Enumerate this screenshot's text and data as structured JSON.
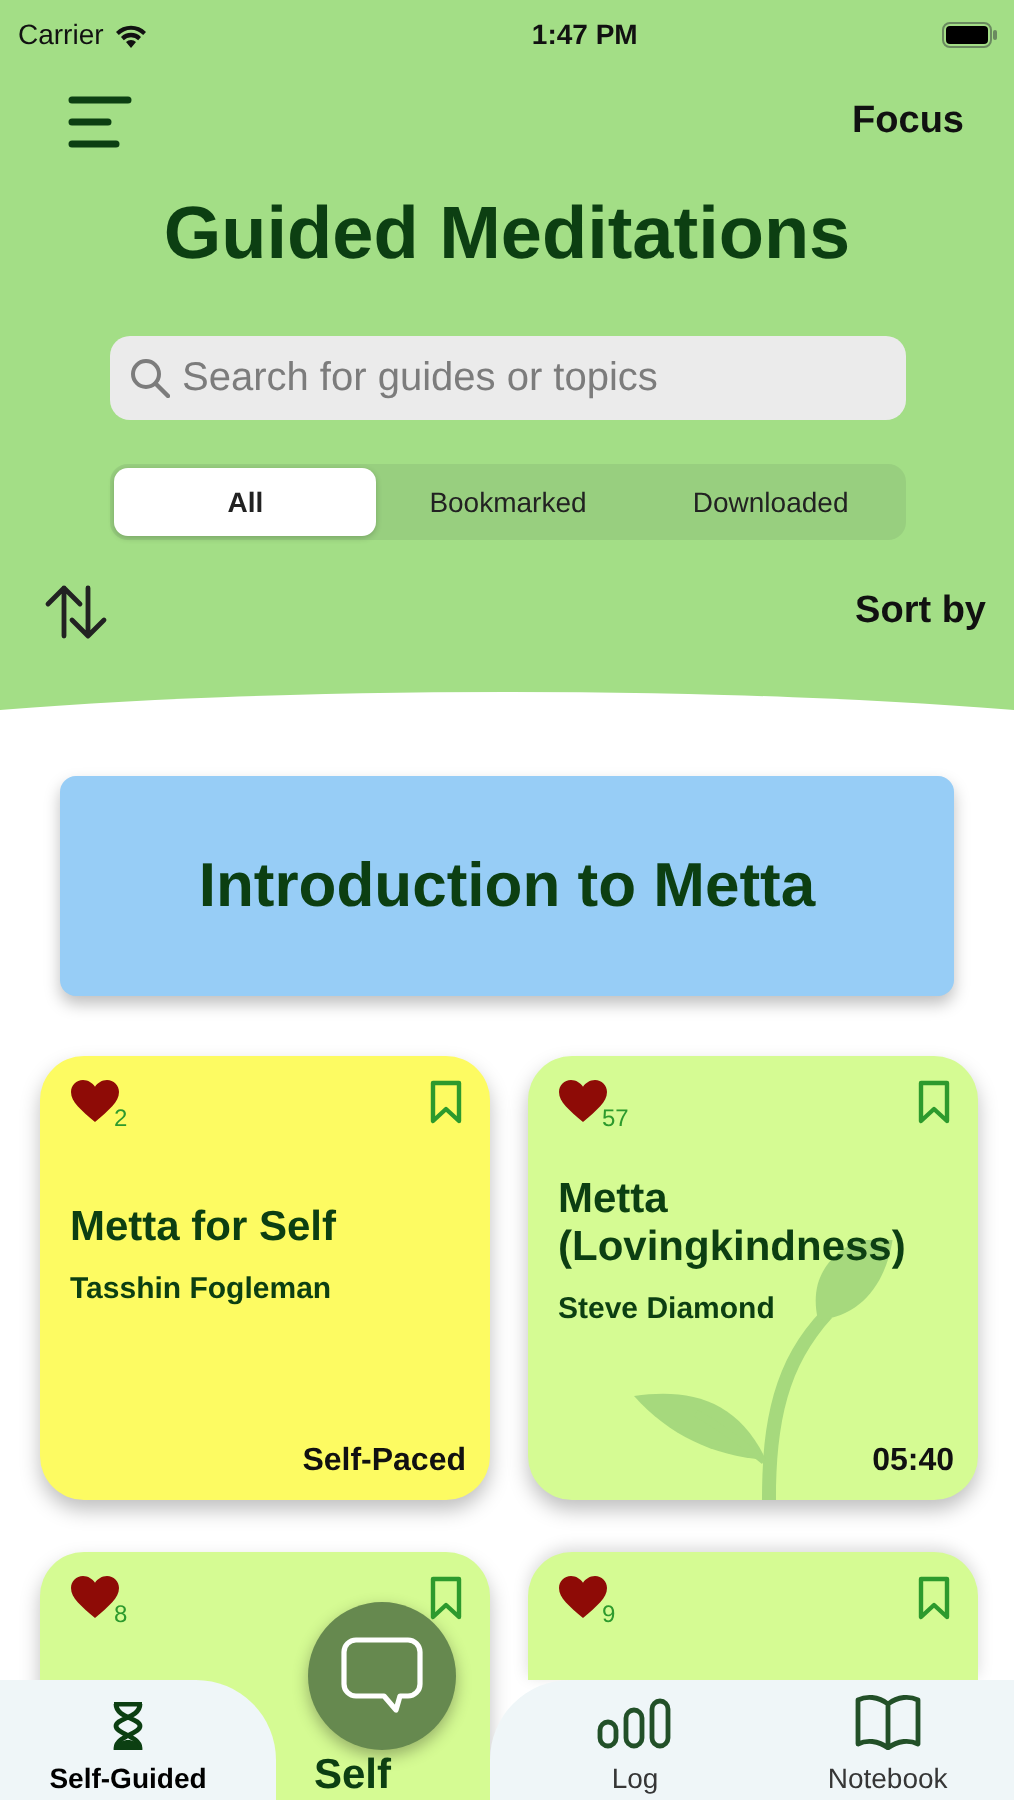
{
  "status_bar": {
    "carrier": "Carrier",
    "time": "1:47 PM"
  },
  "header": {
    "action": "Focus",
    "title": "Guided Meditations",
    "search": {
      "placeholder": "Search for guides or topics"
    },
    "segments": [
      {
        "label": "All",
        "selected": true
      },
      {
        "label": "Bookmarked",
        "selected": false
      },
      {
        "label": "Downloaded",
        "selected": false
      }
    ],
    "sort_label": "Sort by"
  },
  "banner": {
    "title": "Introduction to Metta"
  },
  "cards": [
    {
      "kind": "plain",
      "color": "#fdfb62",
      "likes": "2",
      "title": "Metta for Self",
      "author": "Tasshin Fogleman",
      "footer": "Self-Paced"
    },
    {
      "kind": "sprout",
      "color": "#d5fb93",
      "likes": "57",
      "title": "Metta (Lovingkindness)",
      "author": "Steve Diamond",
      "footer": "05:40"
    },
    {
      "kind": "plain",
      "color": "#d5fb93",
      "likes": "8",
      "title": "Self"
    },
    {
      "kind": "plain",
      "color": "#d5fb93",
      "likes": "9"
    }
  ],
  "tab_bar": [
    {
      "label": "Self-Guided",
      "kind": "hourglass",
      "selected": true
    },
    {
      "label": "Log",
      "kind": "bars",
      "selected": false
    },
    {
      "label": "Notebook",
      "kind": "book",
      "selected": false
    }
  ]
}
